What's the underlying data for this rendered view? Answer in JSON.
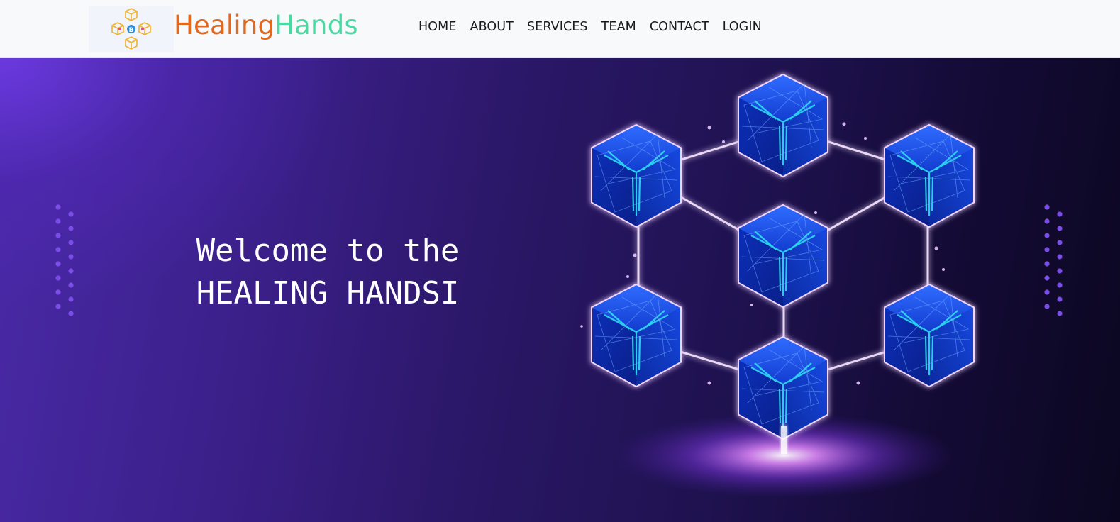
{
  "brand": {
    "part1": "Healing",
    "part2": "Hands",
    "logo_icon": "blockchain-cubes-icon",
    "colors": {
      "part1": "#e2681e",
      "part2": "#4ad9a2"
    }
  },
  "nav": {
    "items": [
      {
        "label": "HOME"
      },
      {
        "label": "ABOUT"
      },
      {
        "label": "SERVICES"
      },
      {
        "label": "TEAM"
      },
      {
        "label": "CONTACT"
      },
      {
        "label": "LOGIN"
      }
    ]
  },
  "hero": {
    "line1": "Welcome to the",
    "line2": "HEALING HANDSI",
    "illustration_icon": "blockchain-network-icon",
    "colors": {
      "bg_light": "#6c3ae2",
      "bg_dark": "#0b0720",
      "cube_glow": "#25e6f5",
      "dots": "#7a4ee6"
    }
  }
}
